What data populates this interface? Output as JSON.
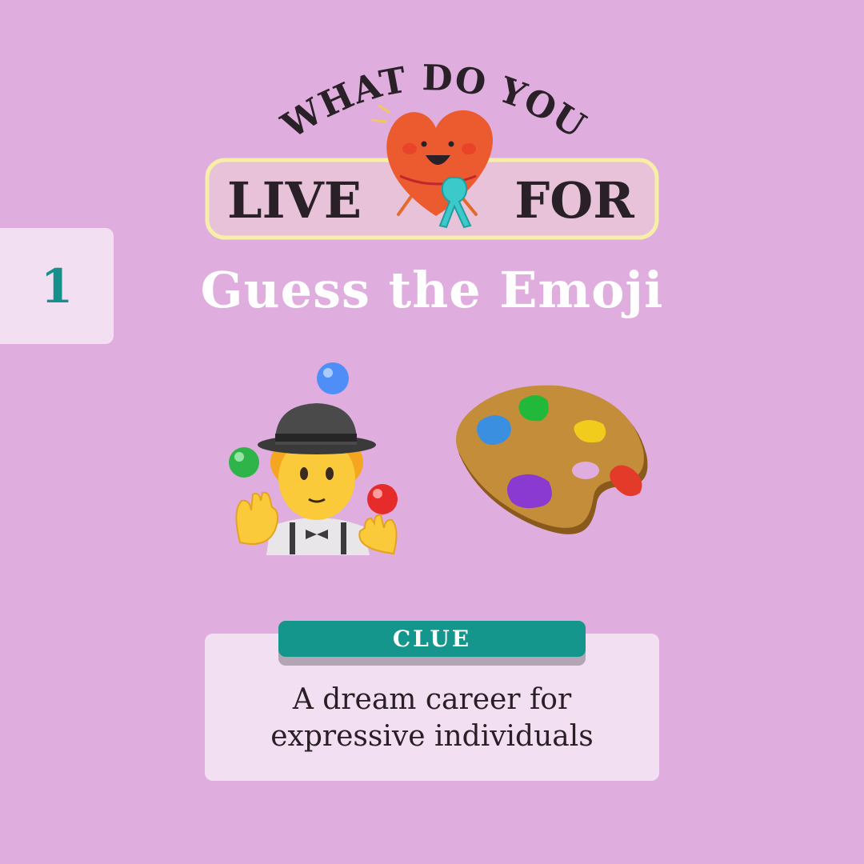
{
  "page": {
    "background": "#dfaede",
    "question_number": "1",
    "number_color": "#16908a"
  },
  "logo": {
    "arc_text": "WHAT DO YOU",
    "left_word": "LIVE",
    "right_word": "FOR",
    "heart_color": "#ec5a30",
    "ribbon_color": "#3cc9c9"
  },
  "subtitle": "Guess the Emoji",
  "emojis": [
    {
      "icon": "person-juggling-emoji"
    },
    {
      "icon": "artist-palette-emoji"
    }
  ],
  "clue": {
    "label": "CLUE",
    "line1": "A dream career for",
    "line2": "expressive individuals",
    "accent": "#14968c"
  }
}
